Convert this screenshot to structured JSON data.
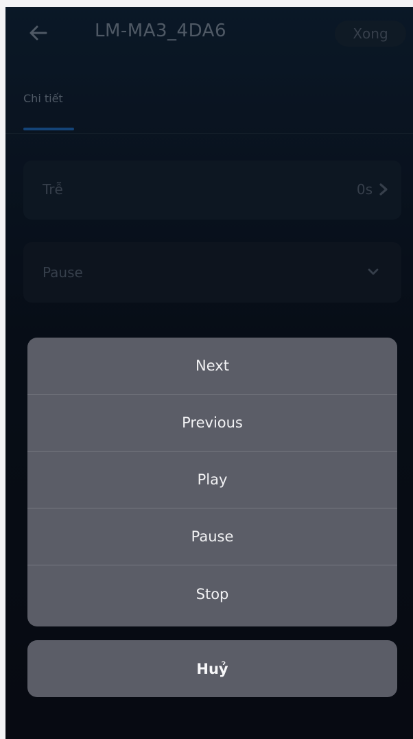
{
  "header": {
    "title": "LM-MA3_4DA6",
    "done_label": "Xong",
    "back_icon": "arrow-left-icon"
  },
  "tabs": [
    {
      "label": "Chi tiết",
      "active": true
    }
  ],
  "delay": {
    "label": "Trễ",
    "value": "0s",
    "chevron_icon": "chevron-right-icon"
  },
  "action_select": {
    "label": "Pause",
    "chevron_icon": "chevron-down-icon"
  },
  "action_sheet": {
    "options": [
      "Next",
      "Previous",
      "Play",
      "Pause",
      "Stop"
    ],
    "cancel_label": "Huỷ"
  },
  "colors": {
    "accent": "#1d5fa7",
    "sheet_bg": "#5b5d67"
  }
}
